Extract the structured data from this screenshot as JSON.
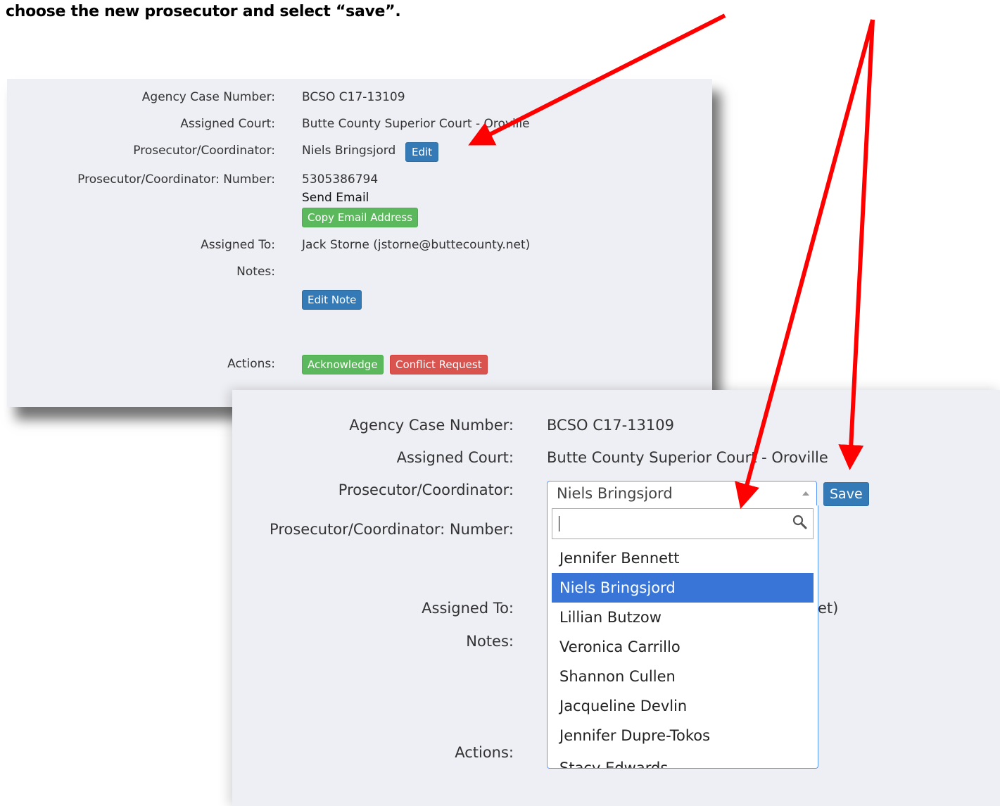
{
  "instruction": "choose the new prosecutor and select “save”.",
  "colors": {
    "arrow": "#ff0000",
    "panel_bg": "#eeeff4",
    "primary_button": "#337ab7",
    "success_button": "#5cb85c",
    "danger_button": "#d9534f",
    "highlight": "#3875d7"
  },
  "panel1": {
    "labels": {
      "case_number": "Agency Case Number:",
      "court": "Assigned Court:",
      "prosecutor": "Prosecutor/Coordinator:",
      "prosecutor_number": "Prosecutor/Coordinator: Number:",
      "assigned_to": "Assigned To:",
      "notes": "Notes:",
      "actions": "Actions:"
    },
    "values": {
      "case_number": "BCSO C17-13109",
      "court": "Butte County Superior Court - Oroville",
      "prosecutor": "Niels Bringsjord",
      "prosecutor_number": "5305386794",
      "send_email": "Send Email",
      "assigned_to": "Jack Storne (jstorne@buttecounty.net)"
    },
    "buttons": {
      "edit": "Edit",
      "copy_email": "Copy Email Address",
      "edit_note": "Edit Note",
      "acknowledge": "Acknowledge",
      "conflict_request": "Conflict Request"
    }
  },
  "panel2": {
    "labels": {
      "case_number": "Agency Case Number:",
      "court": "Assigned Court:",
      "prosecutor": "Prosecutor/Coordinator:",
      "prosecutor_number": "Prosecutor/Coordinator: Number:",
      "assigned_to": "Assigned To:",
      "notes": "Notes:",
      "actions": "Actions:"
    },
    "values": {
      "case_number": "BCSO C17-13109",
      "court": "Butte County Superior Court - Oroville",
      "assigned_to_fragment": "et)"
    },
    "select": {
      "selected": "Niels Bringsjord",
      "search_value": "",
      "options": [
        "Jennifer Bennett",
        "Niels Bringsjord",
        "Lillian Butzow",
        "Veronica Carrillo",
        "Shannon Cullen",
        "Jacqueline Devlin",
        "Jennifer Dupre-Tokos"
      ],
      "partial_option": "Stacy Edwards",
      "highlighted_index": 1
    },
    "buttons": {
      "save": "Save"
    }
  }
}
